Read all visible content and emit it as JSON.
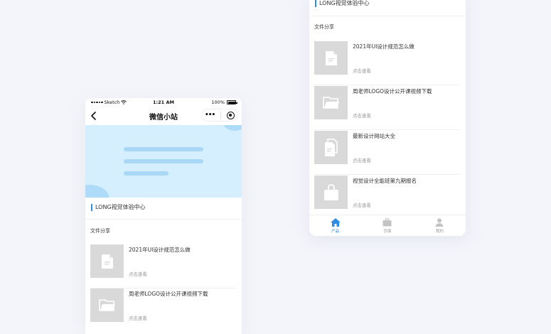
{
  "status_bar": {
    "carrier": "Sketch",
    "time": "1:21 AM",
    "battery": "100%"
  },
  "nav": {
    "title": "微信小站",
    "back_icon": "chevron-left-icon",
    "more_icon": "more-dots-icon",
    "close_icon": "target-icon"
  },
  "section": {
    "title": "LONG视觉体验中心",
    "accent_color": "#2f8ee0"
  },
  "files": {
    "heading": "文件分享",
    "items": [
      {
        "title": "2021年UI设计规范怎么做",
        "action": "点击查看",
        "icon": "document-icon"
      },
      {
        "title": "周老师LOGO设计公开课视频下载",
        "action": "点击查看",
        "icon": "folder-icon"
      },
      {
        "title": "最新设计网站大全",
        "action": "点击查看",
        "icon": "documents-icon"
      },
      {
        "title": "视觉设计全能班第九期报名",
        "action": "点击查看",
        "icon": "bag-icon"
      }
    ]
  },
  "tabs": [
    {
      "label": "产品",
      "icon": "home-icon",
      "active": true
    },
    {
      "label": "页面",
      "icon": "briefcase-icon",
      "active": false
    },
    {
      "label": "我的",
      "icon": "user-icon",
      "active": false
    }
  ]
}
